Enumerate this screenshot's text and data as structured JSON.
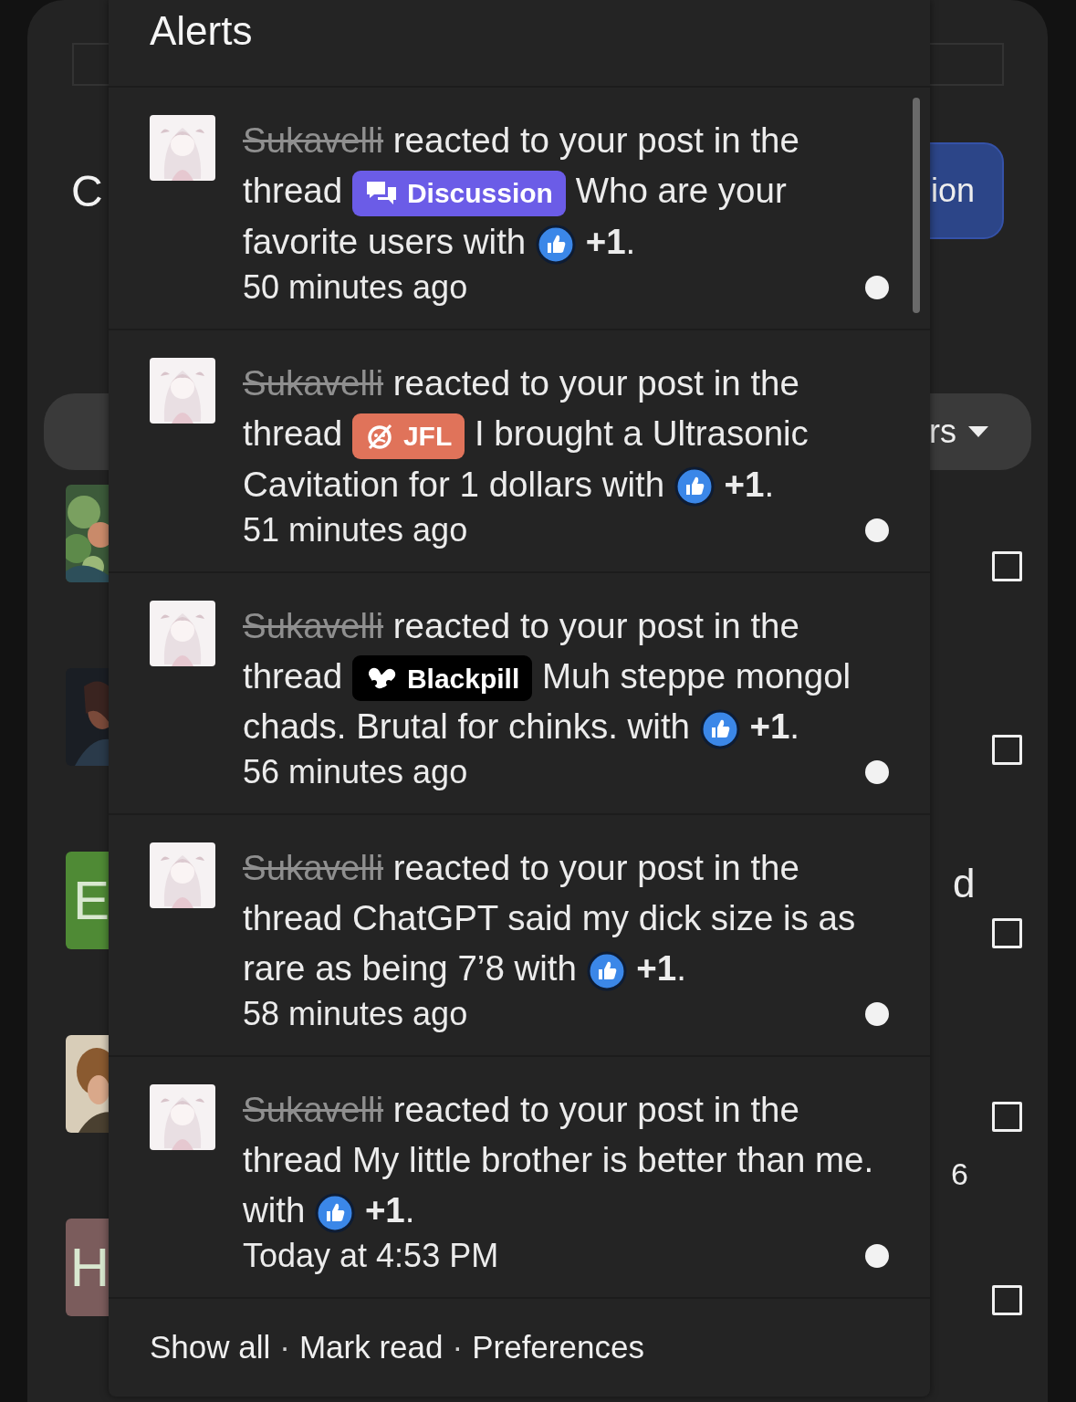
{
  "background": {
    "heading_fragment": "C",
    "button_fragment": "ion",
    "filter_fragment": "rs",
    "rows": [
      {
        "title": "",
        "meta": "",
        "checked": false
      },
      {
        "title": "",
        "meta": "",
        "checked": false
      },
      {
        "thumb": {
          "kind": "letter",
          "letter": "E",
          "color": "#4f8a35"
        },
        "title": "d",
        "meta": "",
        "checked": false
      },
      {
        "title": "",
        "meta": "6",
        "checked": false
      },
      {
        "thumb": {
          "kind": "letter",
          "letter": "H",
          "color": "#7b5c5c"
        },
        "title": "",
        "meta": "",
        "checked": false
      }
    ]
  },
  "alerts": {
    "title": "Alerts",
    "items": [
      {
        "user": "Sukavelli",
        "action": "reacted to your post in the",
        "thread_word": "thread",
        "prefix": {
          "kind": "discussion",
          "label": "Discussion",
          "color": "#6b5ce7"
        },
        "thread_title": "Who are your favorite users",
        "with_word": "with",
        "reaction": "+1",
        "end_mark": ".",
        "time": "50 minutes ago",
        "unread": true
      },
      {
        "user": "Sukavelli",
        "action": "reacted to your post in the",
        "thread_word": "thread",
        "prefix": {
          "kind": "jfl",
          "label": "JFL",
          "color": "#e0735a"
        },
        "thread_title": "I brought a Ultrasonic Cavitation for 1 dollars",
        "with_word": "with",
        "reaction": "+1",
        "end_mark": ".",
        "time": "51 minutes ago",
        "unread": true
      },
      {
        "user": "Sukavelli",
        "action": "reacted to your post in the",
        "thread_word": "thread",
        "prefix": {
          "kind": "blackpill",
          "label": "Blackpill",
          "color": "#000000"
        },
        "thread_title": "Muh steppe mongol chads. Brutal for chinks.",
        "with_word": "with",
        "reaction": "+1",
        "end_mark": ".",
        "time": "56 minutes ago",
        "unread": true
      },
      {
        "user": "Sukavelli",
        "action": "reacted to your post in the",
        "thread_word": "thread",
        "thread_title": "ChatGPT said my dick size is as rare as being 7’8",
        "with_word": "with",
        "reaction": "+1",
        "end_mark": ".",
        "time": "58 minutes ago",
        "unread": true
      },
      {
        "user": "Sukavelli",
        "action": "reacted to your post in the",
        "thread_word": "thread",
        "thread_title": "My little brother is better than me.",
        "with_word": "with",
        "reaction": "+1",
        "end_mark": ".",
        "time": "Today at 4:53 PM",
        "unread": true
      }
    ],
    "footer": {
      "separator": "·",
      "links": [
        "Show all",
        "Mark read",
        "Preferences"
      ]
    }
  }
}
